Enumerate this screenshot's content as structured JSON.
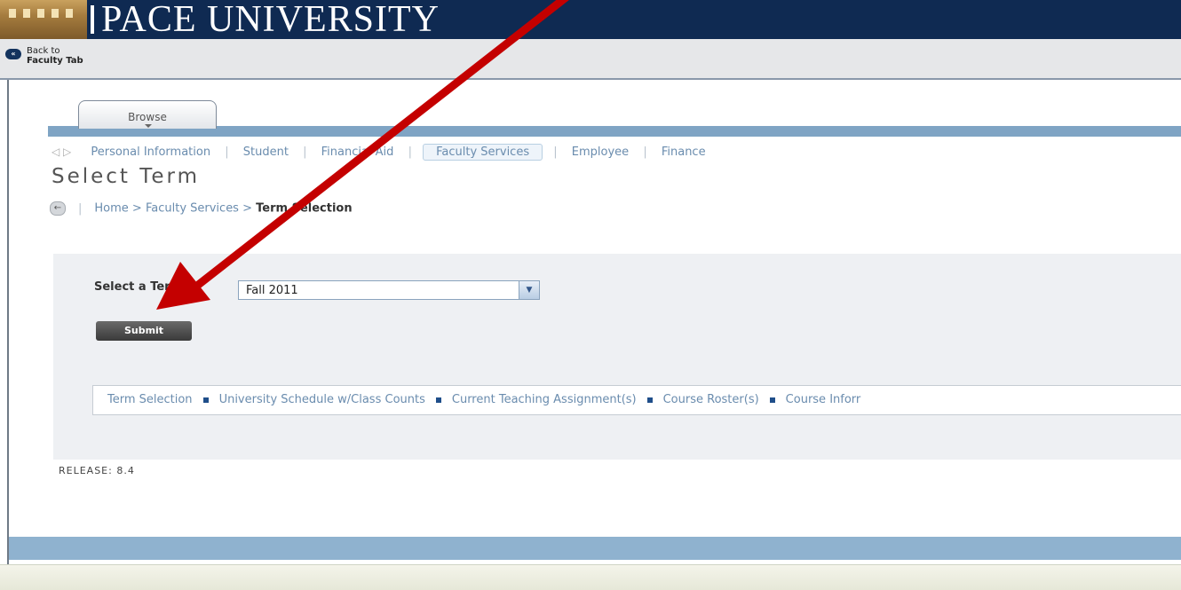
{
  "header": {
    "title": "PACE UNIVERSITY",
    "back_line1": "Back to",
    "back_line2": "Faculty Tab"
  },
  "browse_tab": {
    "label": "Browse"
  },
  "nav": {
    "items": [
      "Personal Information",
      "Student",
      "Financial Aid",
      "Faculty Services",
      "Employee",
      "Finance"
    ],
    "active": "Faculty Services"
  },
  "page": {
    "title": "Select Term"
  },
  "breadcrumb": {
    "home": "Home",
    "section": "Faculty Services",
    "current": "Term Selection",
    "separator": ">"
  },
  "form": {
    "term_label": "Select a Term:",
    "term_value": "Fall 2011",
    "submit_label": "Submit"
  },
  "links": [
    "Term Selection",
    "University Schedule w/Class Counts",
    "Current Teaching Assignment(s)",
    "Course Roster(s)",
    "Course Inforr"
  ],
  "release": "RELEASE: 8.4",
  "colors": {
    "banner": "#0f2a52",
    "nav_link": "#6a8cae",
    "accent_rule": "#7fa4c4",
    "annotation_arrow": "#c40000"
  }
}
